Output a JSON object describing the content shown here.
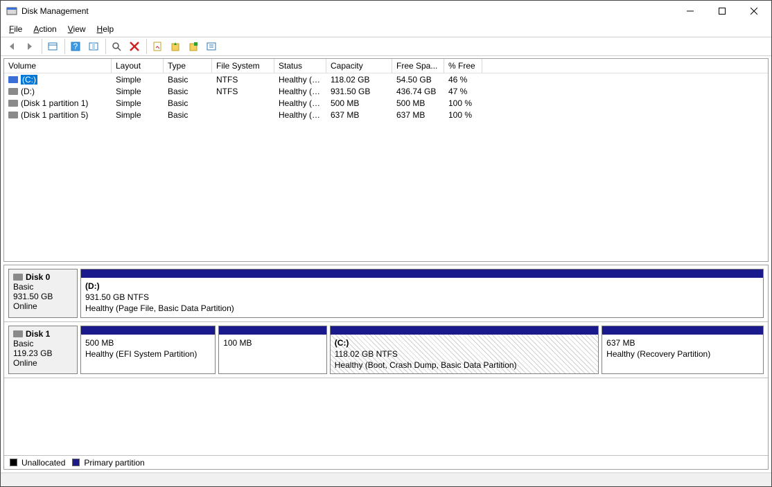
{
  "window": {
    "title": "Disk Management"
  },
  "menu": {
    "file": "File",
    "action": "Action",
    "view": "View",
    "help": "Help",
    "file_u": "F",
    "action_u": "A",
    "view_u": "V",
    "help_u": "H"
  },
  "columns": {
    "volume": "Volume",
    "layout": "Layout",
    "type": "Type",
    "filesystem": "File System",
    "status": "Status",
    "capacity": "Capacity",
    "free": "Free Spa...",
    "pct": "% Free"
  },
  "volumes": [
    {
      "name": "(C:)",
      "layout": "Simple",
      "type": "Basic",
      "fs": "NTFS",
      "status": "Healthy (B...",
      "capacity": "118.02 GB",
      "free": "54.50 GB",
      "pct": "46 %",
      "selected": true,
      "iconCls": "blue"
    },
    {
      "name": "(D:)",
      "layout": "Simple",
      "type": "Basic",
      "fs": "NTFS",
      "status": "Healthy (P...",
      "capacity": "931.50 GB",
      "free": "436.74 GB",
      "pct": "47 %",
      "selected": false,
      "iconCls": ""
    },
    {
      "name": "(Disk 1 partition 1)",
      "layout": "Simple",
      "type": "Basic",
      "fs": "",
      "status": "Healthy (E...",
      "capacity": "500 MB",
      "free": "500 MB",
      "pct": "100 %",
      "selected": false,
      "iconCls": ""
    },
    {
      "name": "(Disk 1 partition 5)",
      "layout": "Simple",
      "type": "Basic",
      "fs": "",
      "status": "Healthy (R...",
      "capacity": "637 MB",
      "free": "637 MB",
      "pct": "100 %",
      "selected": false,
      "iconCls": ""
    }
  ],
  "disks": [
    {
      "name": "Disk 0",
      "type": "Basic",
      "size": "931.50 GB",
      "state": "Online",
      "partitions": [
        {
          "label": "(D:)",
          "size": "931.50 GB NTFS",
          "status": "Healthy (Page File, Basic Data Partition)",
          "flex": 1,
          "selected": false
        }
      ]
    },
    {
      "name": "Disk 1",
      "type": "Basic",
      "size": "119.23 GB",
      "state": "Online",
      "partitions": [
        {
          "label": "",
          "size": "500 MB",
          "status": "Healthy (EFI System Partition)",
          "flex": 20,
          "selected": false
        },
        {
          "label": "",
          "size": "100 MB",
          "status": "",
          "flex": 16,
          "selected": false
        },
        {
          "label": "(C:)",
          "size": "118.02 GB NTFS",
          "status": "Healthy (Boot, Crash Dump, Basic Data Partition)",
          "flex": 40,
          "selected": true
        },
        {
          "label": "",
          "size": "637 MB",
          "status": "Healthy (Recovery Partition)",
          "flex": 24,
          "selected": false
        }
      ]
    }
  ],
  "legend": {
    "unallocated": "Unallocated",
    "primary": "Primary partition"
  }
}
